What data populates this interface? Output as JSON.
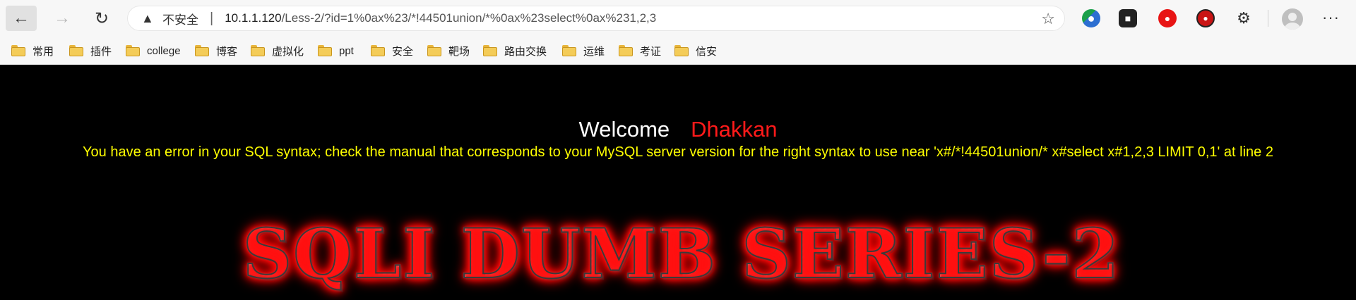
{
  "browser": {
    "address": {
      "security_label": "不安全",
      "separator": "|",
      "host": "10.1.1.120",
      "path": "/Less-2/?id=1%0ax%23/*!44501union/*%0ax%23select%0ax%231,2,3"
    },
    "bookmarks": [
      "常用",
      "插件",
      "college",
      "博客",
      "虚拟化",
      "ppt",
      "安全",
      "靶场",
      "路由交换",
      "运维",
      "考证",
      "信安"
    ]
  },
  "page": {
    "welcome": "Welcome",
    "user": "Dhakkan",
    "error_message": "You have an error in your SQL syntax; check the manual that corresponds to your MySQL server version for the right syntax to use near 'x#/*!44501union/* x#select x#1,2,3 LIMIT 0,1' at line 2",
    "banner": "SQLI DUMB SERIES-2"
  },
  "colors": {
    "page_background": "#000000",
    "welcome_text": "#ffffff",
    "user_text": "#ff1a1a",
    "error_text": "#ffff00",
    "banner_glow": "#ff0000"
  },
  "icons": [
    "back-arrow-icon",
    "forward-arrow-icon",
    "reload-icon",
    "warning-icon",
    "favorite-star-icon",
    "extension-icon",
    "avatar-icon",
    "more-icon",
    "folder-icon"
  ]
}
